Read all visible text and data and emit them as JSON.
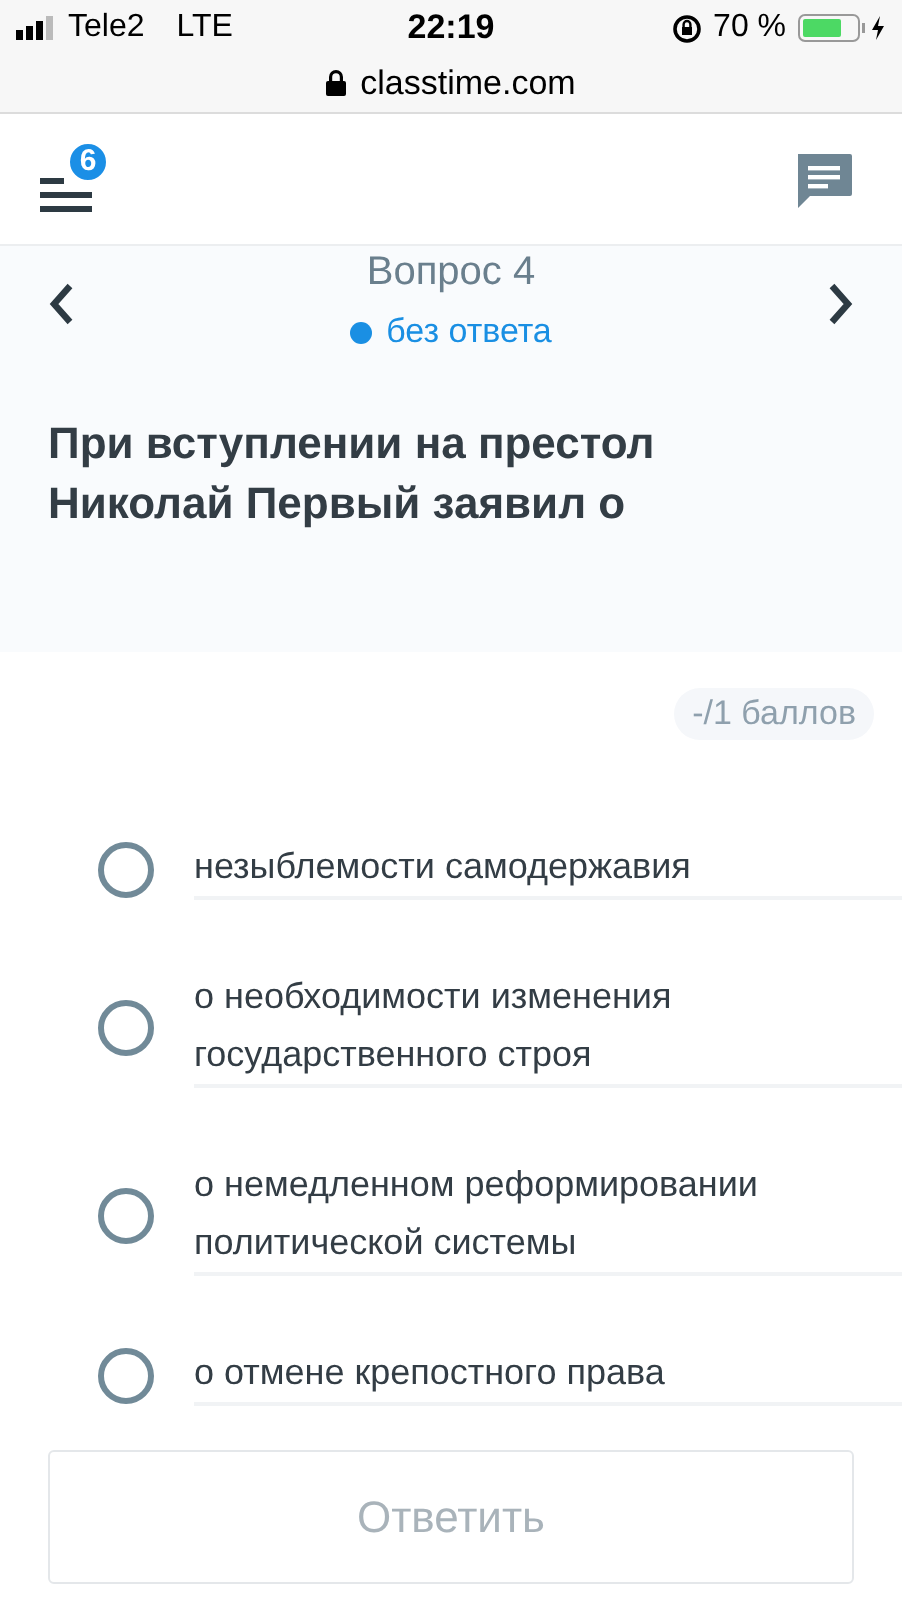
{
  "status_bar": {
    "carrier": "Tele2",
    "network": "LTE",
    "time": "22:19",
    "battery": "70 %"
  },
  "address_bar": {
    "url": "classtime.com"
  },
  "header": {
    "menu_badge": "6"
  },
  "question": {
    "title": "Вопрос 4",
    "status": "без ответа",
    "text": "При вступлении на престол Николай Первый заявил о"
  },
  "score": "-/1 баллов",
  "options": [
    {
      "label": "незыблемости самодержавия",
      "selected": false
    },
    {
      "label": "о необходимости изменения государственного строя",
      "selected": false
    },
    {
      "label": "о немедленном реформировании политической системы",
      "selected": false
    },
    {
      "label": "о отмене крепостного права",
      "selected": false
    }
  ],
  "submit": {
    "label": "Ответить",
    "disabled": true
  }
}
